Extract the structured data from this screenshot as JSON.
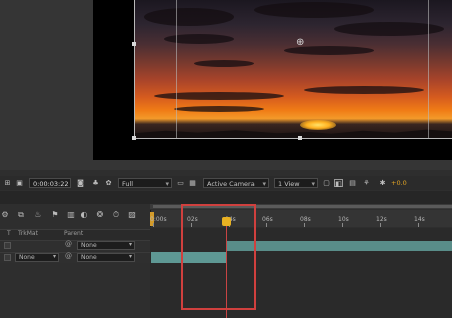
{
  "viewer": {
    "timecode": "0:00:03:22",
    "resolution": "Full",
    "camera": "Active Camera",
    "view_layout": "1 View",
    "exposure": "+0.0"
  },
  "timeline": {
    "columns": {
      "t": "T",
      "trkmat": "TrkMat",
      "parent": "Parent"
    },
    "rows": [
      {
        "trkmat": "",
        "parent": "None"
      },
      {
        "trkmat": "None",
        "parent": "None"
      }
    ],
    "ruler": {
      "labels": [
        "0:00s",
        "02s",
        "04s",
        "06s",
        "08s",
        "10s",
        "12s",
        "14s"
      ],
      "current_time_label": "04s"
    }
  },
  "icons": {
    "viewer_toolbar": [
      "grid-icon",
      "camera-snapshot-icon",
      "color-wheel-icon",
      "region-icon",
      "transparency-grid-icon",
      "3d-view-icon",
      "fast-preview-icon",
      "flowchart-icon",
      "reset-exposure-icon"
    ],
    "timeline_toolbar": [
      "search-layers-icon",
      "composition-mini-flowchart-icon",
      "draft-3d-icon",
      "hide-shy-icon",
      "frame-blending-icon",
      "motion-blur-icon",
      "graph-editor-icon",
      "brainstorm-icon",
      "live-update-icon"
    ]
  },
  "colors": {
    "layer_bar": "#5e9894",
    "current_time_indicator": "#e8b122",
    "highlight": "#d0403e"
  }
}
